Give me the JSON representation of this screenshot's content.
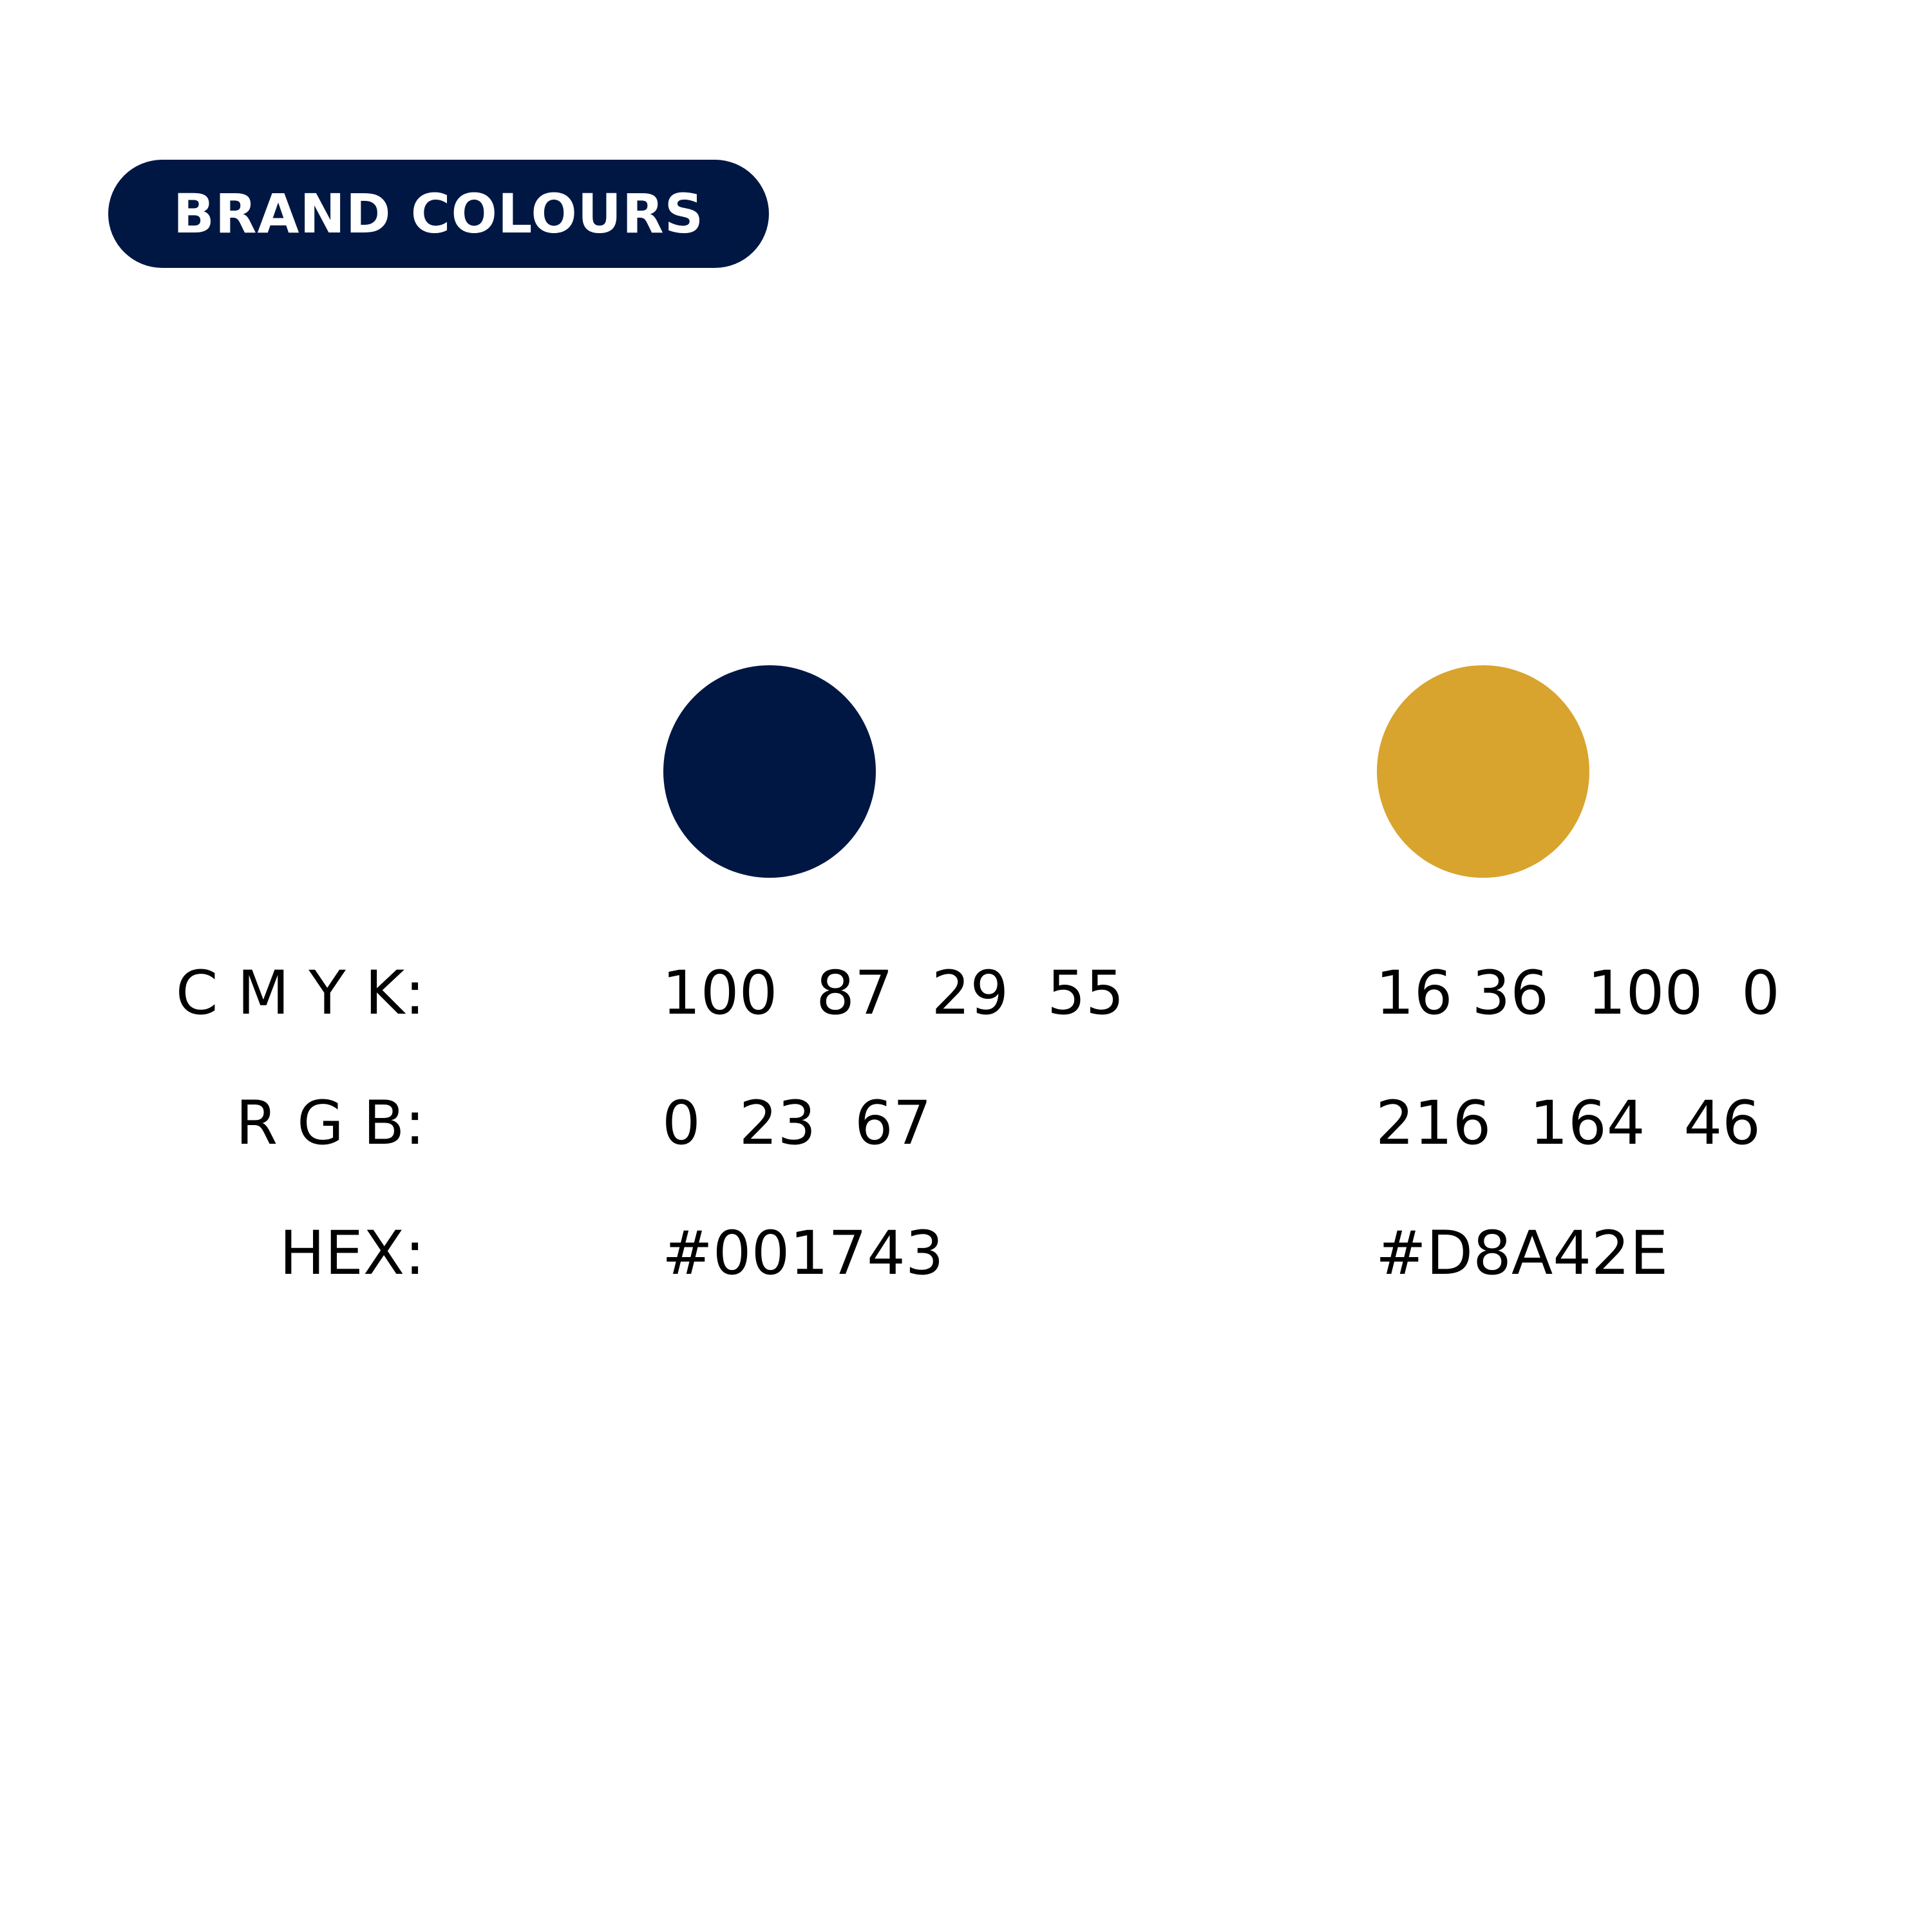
{
  "header": {
    "title": "BRAND COLOURS"
  },
  "labels": {
    "cmyk": "C M Y K:",
    "rgb": "R G B:",
    "hex": "HEX:"
  },
  "colours": [
    {
      "swatch": "#001743",
      "cmyk": "100  87  29  55",
      "rgb": "0  23  67",
      "hex": "#001743"
    },
    {
      "swatch": "#D8A42E",
      "cmyk": "16 36  100  0",
      "rgb": "216  164  46",
      "hex": "#D8A42E"
    }
  ]
}
